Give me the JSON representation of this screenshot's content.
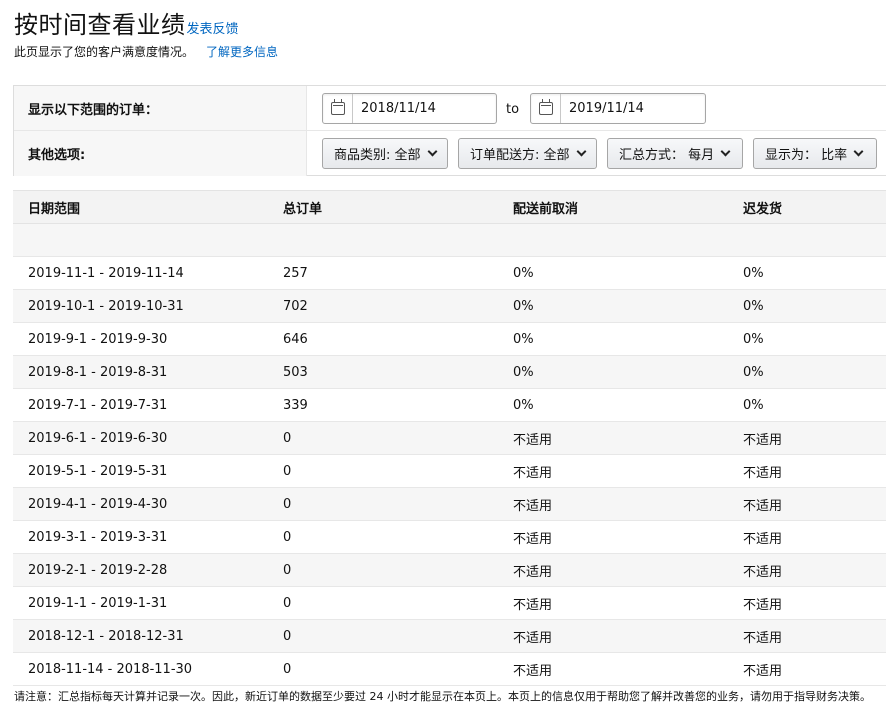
{
  "header": {
    "title": "按时间查看业绩",
    "feedback_link": "发表反馈",
    "subtitle": "此页显示了您的客户满意度情况。",
    "learn_more": "了解更多信息"
  },
  "filters": {
    "date_range_label": "显示以下范围的订单：",
    "start_date": "2018/11/14",
    "to_label": "to",
    "end_date": "2019/11/14",
    "other_options_label": "其他选项:",
    "category": "商品类别: 全部",
    "fulfillment": "订单配送方: 全部",
    "aggregation": "汇总方式： 每月",
    "display_as": "显示为： 比率"
  },
  "table": {
    "headers": [
      "日期范围",
      "总订单",
      "配送前取消",
      "迟发货"
    ],
    "rows": [
      [
        "2019-11-1 - 2019-11-14",
        "257",
        "0%",
        "0%"
      ],
      [
        "2019-10-1 - 2019-10-31",
        "702",
        "0%",
        "0%"
      ],
      [
        "2019-9-1 - 2019-9-30",
        "646",
        "0%",
        "0%"
      ],
      [
        "2019-8-1 - 2019-8-31",
        "503",
        "0%",
        "0%"
      ],
      [
        "2019-7-1 - 2019-7-31",
        "339",
        "0%",
        "0%"
      ],
      [
        "2019-6-1 - 2019-6-30",
        "0",
        "不适用",
        "不适用"
      ],
      [
        "2019-5-1 - 2019-5-31",
        "0",
        "不适用",
        "不适用"
      ],
      [
        "2019-4-1 - 2019-4-30",
        "0",
        "不适用",
        "不适用"
      ],
      [
        "2019-3-1 - 2019-3-31",
        "0",
        "不适用",
        "不适用"
      ],
      [
        "2019-2-1 - 2019-2-28",
        "0",
        "不适用",
        "不适用"
      ],
      [
        "2019-1-1 - 2019-1-31",
        "0",
        "不适用",
        "不适用"
      ],
      [
        "2018-12-1 - 2018-12-31",
        "0",
        "不适用",
        "不适用"
      ],
      [
        "2018-11-14 - 2018-11-30",
        "0",
        "不适用",
        "不适用"
      ]
    ]
  },
  "footer": {
    "note": "请注意：汇总指标每天计算并记录一次。因此，新近订单的数据至少要过 24 小时才能显示在本页上。本页上的信息仅用于帮助您了解并改善您的业务，请勿用于指导财务决策。"
  },
  "icons": {
    "calendar": "calendar-icon",
    "dropdown": "chevron-down-icon"
  },
  "colors": {
    "link": "#0066c0",
    "header_bg": "#f3f3f3",
    "row_alt_bg": "#f6f6f6"
  }
}
